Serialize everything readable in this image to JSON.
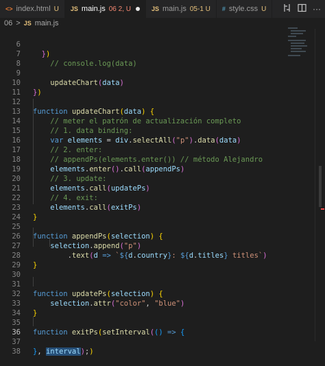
{
  "tabs": [
    {
      "icon": "<>",
      "name": "index.html",
      "status": "U"
    },
    {
      "icon": "JS",
      "name": "main.js",
      "status": "06 2, U",
      "active": true,
      "dirty": true
    },
    {
      "icon": "JS",
      "name": "main.js",
      "status": "05-1 U"
    },
    {
      "icon": "#",
      "name": "style.css",
      "status": "U"
    }
  ],
  "breadcrumb": {
    "folder": "06",
    "sep": ">",
    "icon": "JS",
    "file": "main.js"
  },
  "icons": {
    "html": "html-file-icon",
    "js": "js-file-icon",
    "css": "css-file-icon",
    "actions": [
      "compare-changes-icon",
      "split-editor-icon",
      "more-actions-icon"
    ]
  },
  "colors": {
    "background": "#1e1e1e",
    "keyword": "#569cd6",
    "function": "#dcdcaa",
    "variable": "#9cdcfe",
    "string": "#ce9178",
    "comment": "#6a9955"
  },
  "lines": [
    {
      "n": "6",
      "t": "  })"
    },
    {
      "n": "7",
      "t": "    // console.log(data)"
    },
    {
      "n": "8",
      "t": ""
    },
    {
      "n": "9",
      "t": "    updateChart(data)"
    },
    {
      "n": "10",
      "t": "})"
    },
    {
      "n": "11",
      "t": ""
    },
    {
      "n": "12",
      "t": "function updateChart(data) {"
    },
    {
      "n": "13",
      "t": "    // meter el patrón de actualización completo"
    },
    {
      "n": "14",
      "t": "    // 1. data binding:"
    },
    {
      "n": "15",
      "t": "    var elements = div.selectAll(\"p\").data(data)"
    },
    {
      "n": "16",
      "t": "    // 2. enter:"
    },
    {
      "n": "17",
      "t": "    // appendPs(elements.enter()) // método Alejandro"
    },
    {
      "n": "18",
      "t": "    elements.enter().call(appendPs)"
    },
    {
      "n": "19",
      "t": "    // 3. update:"
    },
    {
      "n": "20",
      "t": "    elements.call(updatePs)"
    },
    {
      "n": "21",
      "t": "    // 4. exit:"
    },
    {
      "n": "22",
      "t": "    elements.call(exitPs)"
    },
    {
      "n": "23",
      "t": "}"
    },
    {
      "n": "24",
      "t": ""
    },
    {
      "n": "25",
      "t": "function appendPs(selection) {"
    },
    {
      "n": "26",
      "t": "    selection.append(\"p\")"
    },
    {
      "n": "27",
      "t": "        .text(d => `${d.country}: ${d.titles} titles`)"
    },
    {
      "n": "28",
      "t": "}"
    },
    {
      "n": "29",
      "t": ""
    },
    {
      "n": "30",
      "t": ""
    },
    {
      "n": "31",
      "t": "function updatePs(selection) {"
    },
    {
      "n": "32",
      "t": "    selection.attr(\"color\", \"blue\")"
    },
    {
      "n": "33",
      "t": "}"
    },
    {
      "n": "34",
      "t": ""
    },
    {
      "n": "35",
      "t": "function exitPs(setInterval(() => {"
    },
    {
      "n": "36",
      "t": ""
    },
    {
      "n": "37",
      "t": "}, interval);)"
    },
    {
      "n": "38",
      "t": ""
    }
  ]
}
